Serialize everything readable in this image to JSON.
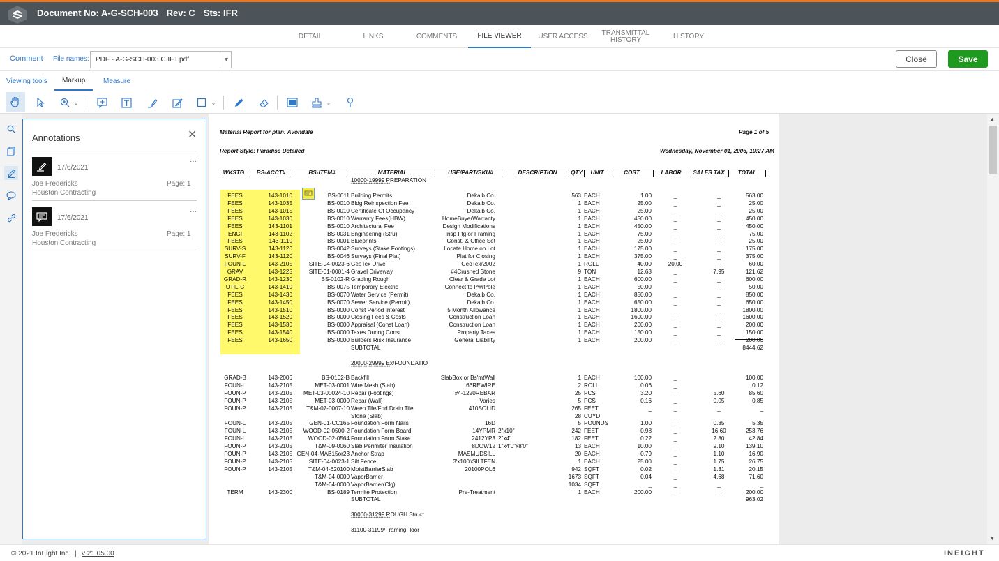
{
  "header": {
    "doc_no": "Document No: A-G-SCH-003",
    "rev": "Rev: C",
    "sts": "Sts: IFR"
  },
  "tabs": [
    "DETAIL",
    "LINKS",
    "COMMENTS",
    "FILE VIEWER",
    "USER ACCESS",
    "TRANSMITTAL HISTORY",
    "HISTORY"
  ],
  "comment_row": {
    "comment": "Comment",
    "file_names_label": "File names:",
    "file_value": "PDF - A-G-SCH-003.C.IFT.pdf",
    "close": "Close",
    "save": "Save"
  },
  "tool_tabs": [
    "Viewing tools",
    "Markup",
    "Measure"
  ],
  "annotations": {
    "title": "Annotations",
    "items": [
      {
        "date": "17/6/2021",
        "author": "Joe Fredericks",
        "company": "Houston Contracting",
        "page": "Page: 1"
      },
      {
        "date": "17/6/2021",
        "author": "Joe Fredericks",
        "company": "Houston Contracting",
        "page": "Page: 1"
      }
    ]
  },
  "doc": {
    "title": "Material Report for plan: Avondale",
    "page": "Page 1 of 5",
    "style": "Report Style: Paradise Detailed",
    "date": "Wednesday, November 01, 2006, 10:27 AM",
    "headers": [
      "WKSTG",
      "BS-ACCT#",
      "BS-ITEM#",
      "MATERIAL",
      "USE/PART/SKU#",
      "DESCRIPTION",
      "QTY",
      "UNIT",
      "COST",
      "LABOR",
      "SALES TAX",
      "TOTAL"
    ],
    "sec1": "10000-19999 PREPARATION",
    "stars": "************************",
    "rows1": [
      [
        "FEES",
        "143-1010",
        "BS-0011",
        "Building Permits",
        "Dekalb Co.",
        "",
        "563",
        "EACH",
        "1.00",
        "_",
        "_",
        "563.00"
      ],
      [
        "FEES",
        "143-1035",
        "BS-0010",
        "Bldg Reinspection Fee",
        "Dekalb Co.",
        "",
        "1",
        "EACH",
        "25.00",
        "_",
        "_",
        "25.00"
      ],
      [
        "FEES",
        "143-1015",
        "BS-0010",
        "Certificate Of Occupancy",
        "Dekalb Co.",
        "",
        "1",
        "EACH",
        "25.00",
        "_",
        "_",
        "25.00"
      ],
      [
        "FEES",
        "143-1030",
        "BS-0010",
        "Warranty Fees(HBW)",
        "HomeBuyerWarranty",
        "",
        "1",
        "EACH",
        "450.00",
        "_",
        "_",
        "450.00"
      ],
      [
        "FEES",
        "143-1101",
        "BS-0010",
        "Architectural Fee",
        "Design Modifications",
        "",
        "1",
        "EACH",
        "450.00",
        "_",
        "_",
        "450.00"
      ],
      [
        "ENGI",
        "143-1102",
        "BS-0031",
        "Engineering (Stru)",
        "Insp Ftg or Framing",
        "",
        "1",
        "EACH",
        "75.00",
        "_",
        "_",
        "75.00"
      ],
      [
        "FEES",
        "143-1110",
        "BS-0001",
        "Blueprints",
        "Const. & Office Set",
        "",
        "1",
        "EACH",
        "25.00",
        "_",
        "_",
        "25.00"
      ],
      [
        "SURV-S",
        "143-1120",
        "BS-0042",
        "Surveys (Stake Footings)",
        "Locate Home on Lot",
        "",
        "1",
        "EACH",
        "175.00",
        "_",
        "_",
        "175.00"
      ],
      [
        "SURV-F",
        "143-1120",
        "BS-0046",
        "Surveys (Final Plat)",
        "Plat for Closing",
        "",
        "1",
        "EACH",
        "375.00",
        "_",
        "_",
        "375.00"
      ],
      [
        "FOUN-L",
        "143-2105",
        "SITE-04-0023-6",
        "GeoTex Drive",
        "GeoTex/2002",
        "",
        "1",
        "ROLL",
        "40.00",
        "20.00",
        "_",
        "60.00"
      ],
      [
        "GRAV",
        "143-1225",
        "SITE-01-0001-4",
        "Gravel Driveway",
        "#4Crushed Stone",
        "",
        "9",
        "TON",
        "12.63",
        "_",
        "7.95",
        "121.62"
      ],
      [
        "GRAD-R",
        "143-1230",
        "BS-0102-R",
        "Grading Rough",
        "Clear & Grade Lot",
        "",
        "1",
        "EACH",
        "600.00",
        "_",
        "_",
        "600.00"
      ],
      [
        "UTIL-C",
        "143-1410",
        "BS-0075",
        "Temporary Electric",
        "Connect to PwrPole",
        "",
        "1",
        "EACH",
        "50.00",
        "_",
        "_",
        "50.00"
      ],
      [
        "FEES",
        "143-1430",
        "BS-0070",
        "Water Service  (Permit)",
        "Dekalb Co.",
        "",
        "1",
        "EACH",
        "850.00",
        "_",
        "_",
        "850.00"
      ],
      [
        "FEES",
        "143-1450",
        "BS-0070",
        "Sewer  Service (Permit)",
        "Dekalb Co.",
        "",
        "1",
        "EACH",
        "650.00",
        "_",
        "_",
        "650.00"
      ],
      [
        "FEES",
        "143-1510",
        "BS-0000",
        "Const Period Interest",
        "5 Month Allowance",
        "",
        "1",
        "EACH",
        "1800.00",
        "_",
        "_",
        "1800.00"
      ],
      [
        "FEES",
        "143-1520",
        "BS-0000",
        "Closing Fees & Costs",
        "Construction Loan",
        "",
        "1",
        "EACH",
        "1600.00",
        "_",
        "_",
        "1600.00"
      ],
      [
        "FEES",
        "143-1530",
        "BS-0000",
        "Appraisal (Const Loan)",
        "Construction Loan",
        "",
        "1",
        "EACH",
        "200.00",
        "_",
        "_",
        "200.00"
      ],
      [
        "FEES",
        "143-1540",
        "BS-0000",
        "Taxes During Const",
        "Property Taxes",
        "",
        "1",
        "EACH",
        "150.00",
        "_",
        "_",
        "150.00"
      ],
      [
        "FEES",
        "143-1650",
        "BS-0000",
        "Builders Risk Insurance",
        "General Liability",
        "",
        "1",
        "EACH",
        "200.00",
        "_",
        "_",
        "200.00"
      ]
    ],
    "subtotal": "SUBTOTAL",
    "sub1": "8444.62",
    "sec2": "20000-29999 Ex/FOUNDATIO",
    "rows2": [
      [
        "GRAD-B",
        "143-2006",
        "BS-0102-B",
        "Backfill",
        "SlabBox or Bs'mtWall",
        "",
        "1",
        "EACH",
        "100.00",
        "_",
        "",
        "100.00"
      ],
      [
        "FOUN-L",
        "143-2105",
        "MET-03-0001",
        "Wire Mesh (Slab)",
        "66REWIRE",
        "",
        "2",
        "ROLL",
        "0.06",
        "_",
        "",
        "0.12"
      ],
      [
        "FOUN-P",
        "143-2105",
        "MET-03-00024-10",
        "Rebar (Footings)",
        "#4-1220REBAR",
        "",
        "25",
        "PCS",
        "3.20",
        "_",
        "5.60",
        "85.60"
      ],
      [
        "FOUN-P",
        "143-2105",
        "MET-03-0000",
        "Rebar (Wall)",
        "Varies",
        "",
        "5",
        "PCS",
        "0.16",
        "_",
        "0.05",
        "0.85"
      ],
      [
        "FOUN-P",
        "143-2105",
        "T&M-07-0007-10",
        "Weep Tile/Fnd Drain Tile",
        "410SOLID",
        "",
        "265",
        "FEET",
        "_",
        "_",
        "_",
        "_"
      ],
      [
        "",
        "",
        "",
        "Stone (Slab)",
        "",
        "",
        "28",
        "CUYD",
        "_",
        "_",
        "_",
        "_"
      ],
      [
        "FOUN-L",
        "143-2105",
        "GEN-01-CC165",
        "Foundation Form Nails",
        "16D",
        "",
        "5",
        "POUNDS",
        "1.00",
        "_",
        "0.35",
        "5.35"
      ],
      [
        "FOUN-L",
        "143-2105",
        "WOOD-02-0500-2",
        "Foundation Form Board",
        "14YPMR",
        "2\"x10\"",
        "242",
        "FEET",
        "0.98",
        "_",
        "16.60",
        "253.76"
      ],
      [
        "FOUN-L",
        "143-2105",
        "WOOD-02-0564",
        "Foundation Form Stake",
        "2412YP3",
        "2\"x4\"",
        "182",
        "FEET",
        "0.22",
        "_",
        "2.80",
        "42.84"
      ],
      [
        "FOUN-P",
        "143-2105",
        "T&M-09-0060",
        "Slab Perimiter Insulation",
        "8DOW12",
        "1\"x4'0\"x8'0\"",
        "13",
        "EACH",
        "10.00",
        "_",
        "9.10",
        "139.10"
      ],
      [
        "FOUN-P",
        "143-2105",
        "GEN-04-MAB15or23",
        "Anchor Strap",
        "MASMUDSILL",
        "",
        "20",
        "EACH",
        "0.79",
        "_",
        "1.10",
        "16.90"
      ],
      [
        "FOUN-P",
        "143-2105",
        "SITE-04-0023-1",
        "Silt Fence",
        "3'x100'/SILTFEN",
        "",
        "1",
        "EACH",
        "25.00",
        "_",
        "1.75",
        "26.75"
      ],
      [
        "FOUN-P",
        "143-2105",
        "T&M-04-620100",
        "MoistBarrierSlab",
        "20100POL6",
        "",
        "942",
        "SQFT",
        "0.02",
        "_",
        "1.31",
        "20.15"
      ],
      [
        "",
        "",
        "T&M-04-0000",
        "VaporBarrier",
        "",
        "",
        "1673",
        "SQFT",
        "0.04",
        "_",
        "4.68",
        "71.60"
      ],
      [
        "",
        "",
        "T&M-04-0000",
        "VaporBarrier(Clg)",
        "",
        "",
        "1034",
        "SQFT",
        "_",
        "_",
        "_",
        "_"
      ],
      [
        "TERM",
        "143-2300",
        "BS-0189",
        "Termite Protection",
        "Pre-Treatment",
        "",
        "1",
        "EACH",
        "200.00",
        "_",
        "_",
        "200.00"
      ]
    ],
    "sub2": "963.02",
    "sec3": "30000-31299 ROUGH Struct",
    "sec4": "31100-31199/FramingFloor"
  },
  "footer": {
    "copy": "© 2021 InEight Inc.",
    "sep": "|",
    "version": "v 21.05.00",
    "brand": "INEIGHT"
  }
}
